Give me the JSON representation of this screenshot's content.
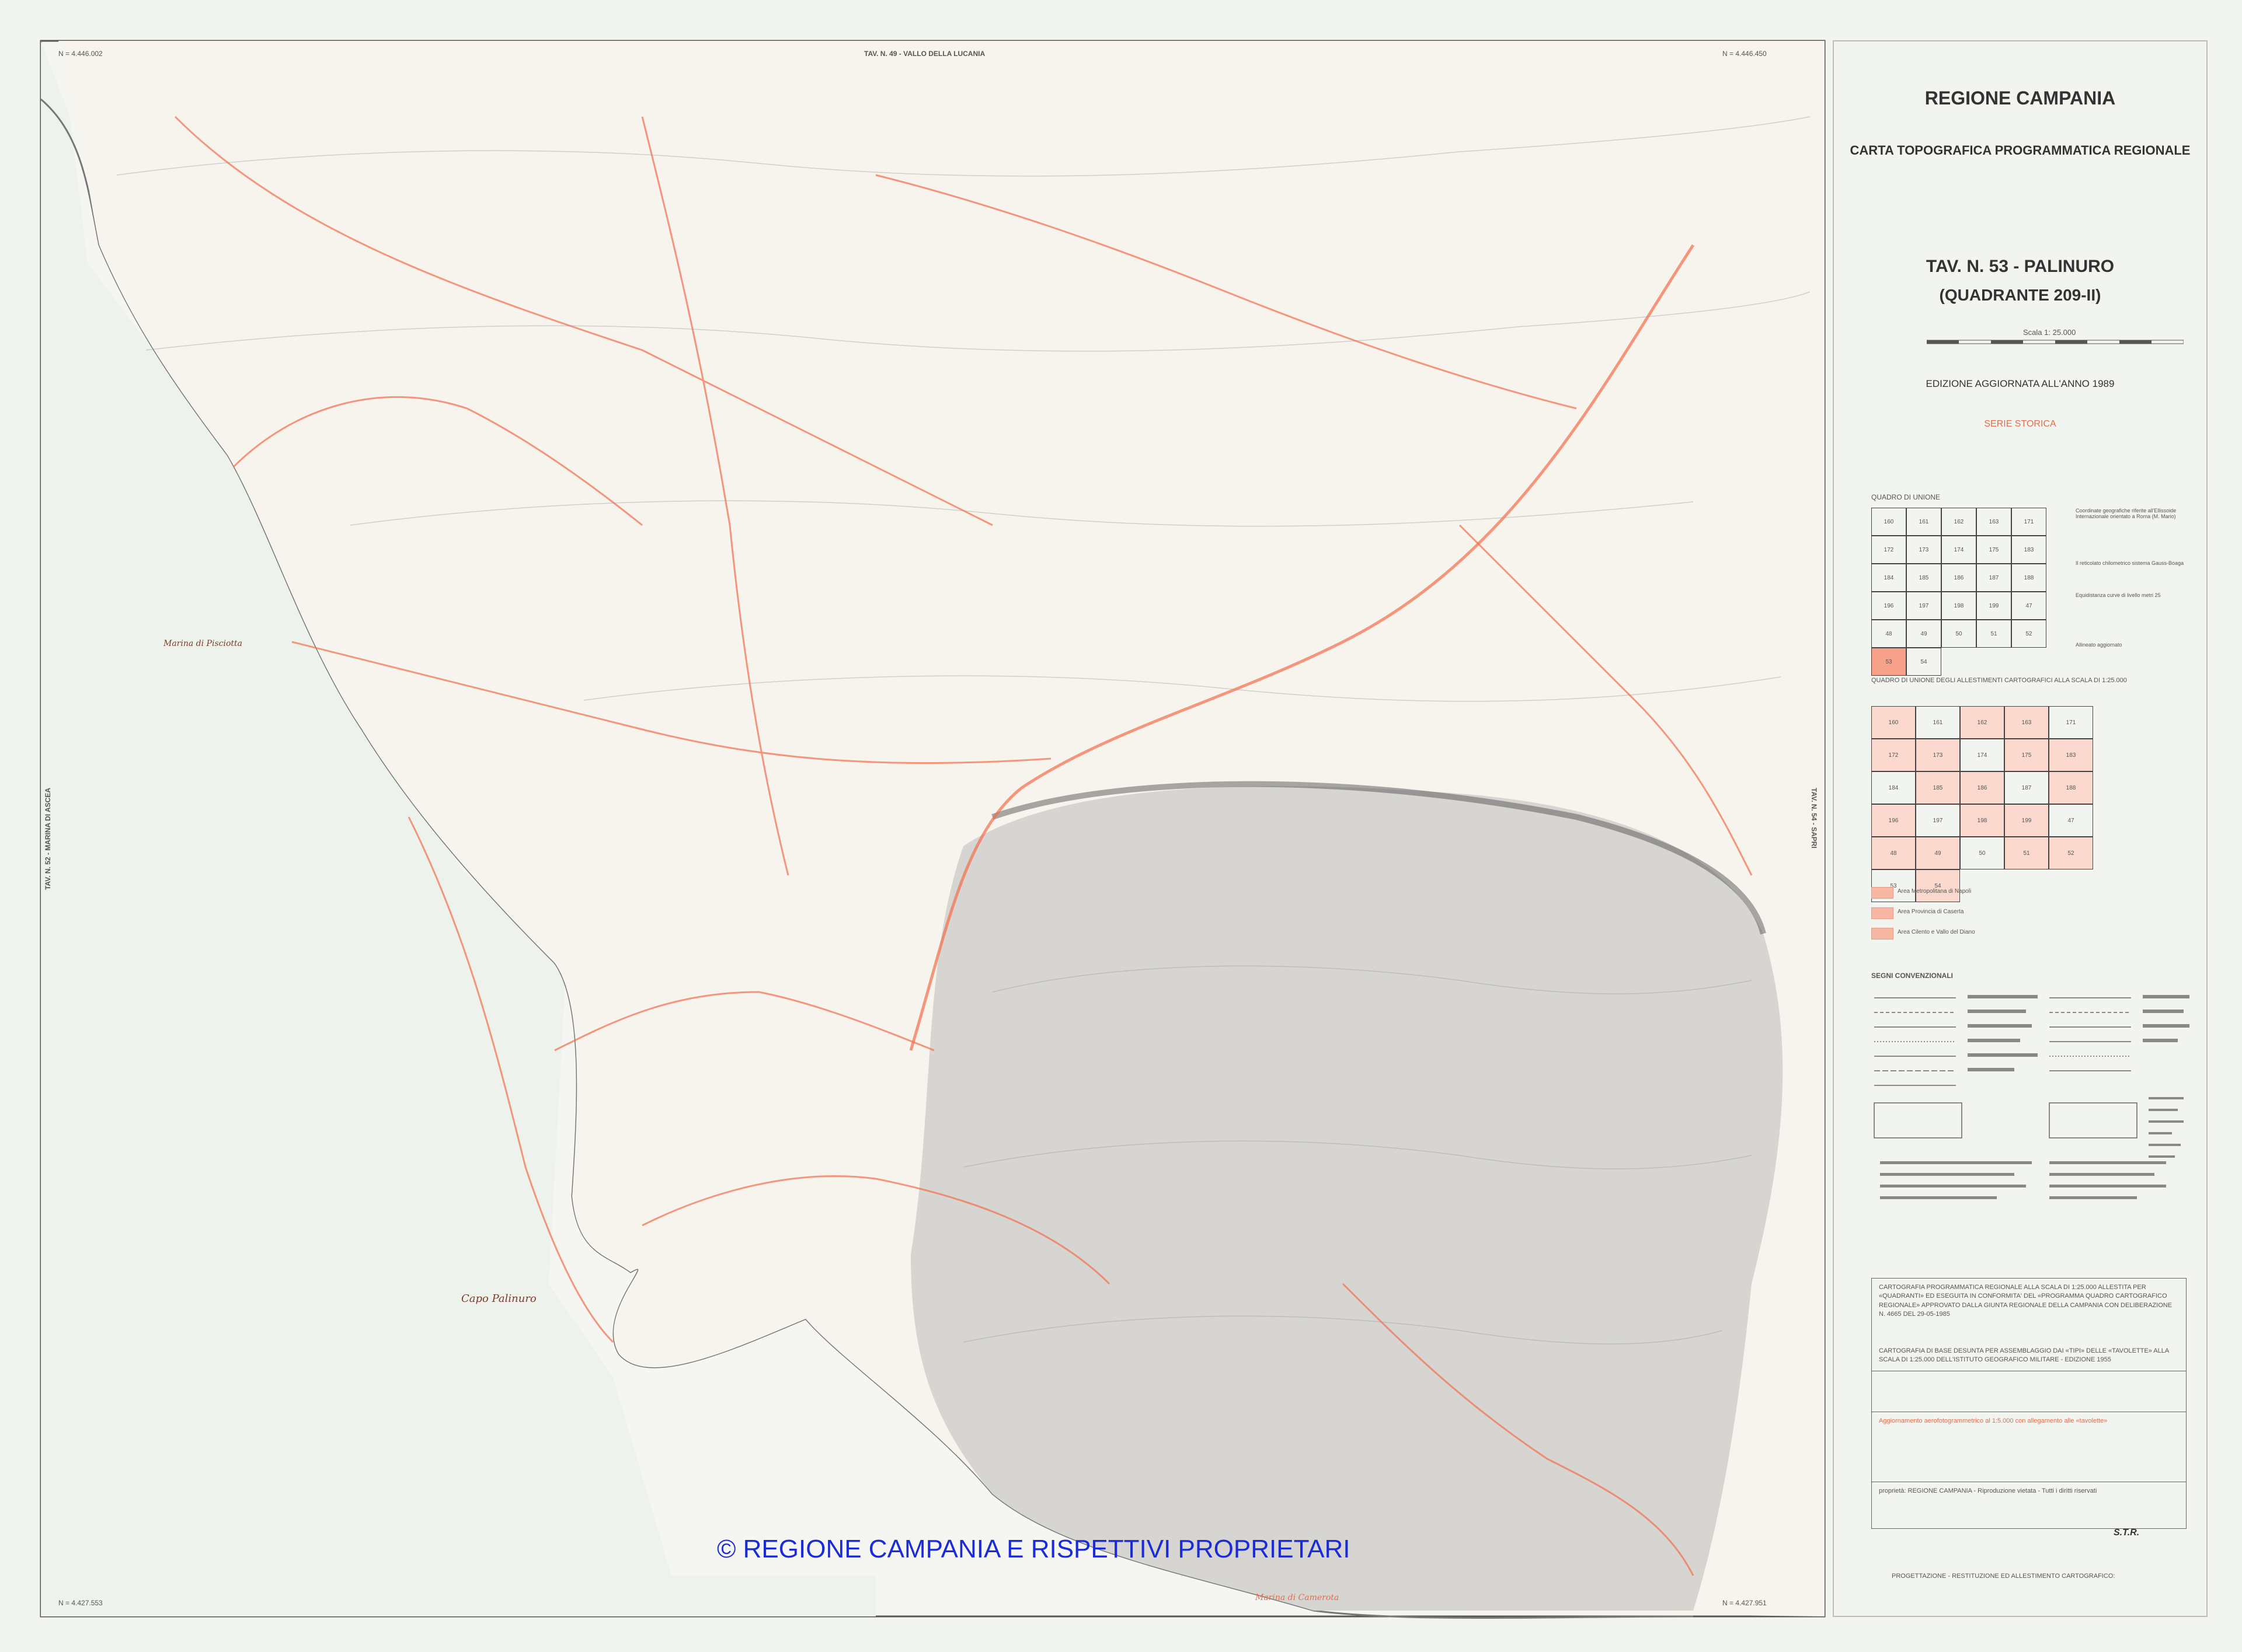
{
  "header": {
    "region": "REGIONE CAMPANIA",
    "subtitle": "CARTA TOPOGRAFICA PROGRAMMATICA REGIONALE",
    "sheet_title": "TAV. N. 53 - PALINURO",
    "quadrant": "(QUADRANTE 209-II)",
    "scale_label": "Scala 1: 25.000",
    "edition": "EDIZIONE AGGIORNATA ALL'ANNO 1989",
    "series": "SERIE STORICA"
  },
  "frame": {
    "top": "TAV. N. 49 - VALLO DELLA LUCANIA",
    "left": "TAV. N. 52 - MARINA DI ASCEA",
    "right": "TAV. N. 54 - SAPRI",
    "coord_top_left": "N = 4.446.002",
    "coord_top_right": "N = 4.446.450",
    "coord_bottom_left": "N = 4.427.553",
    "coord_bottom_right": "N = 4.427.951"
  },
  "index_panel": {
    "title1": "QUADRO DI UNIONE",
    "title2": "QUADRO DI UNIONE DEGLI ALLESTIMENTI CARTOGRAFICI ALLA SCALA DI 1:25.000",
    "grid1": [
      "160",
      "161",
      "162",
      "163",
      "171",
      "172",
      "173",
      "174",
      "175",
      "183",
      "184",
      "185",
      "186",
      "187",
      "188",
      "196",
      "197",
      "198",
      "199",
      "47",
      "48",
      "49",
      "50",
      "51",
      "52",
      "53",
      "54"
    ],
    "grid2": [
      "160",
      "161",
      "162",
      "163",
      "171",
      "172",
      "173",
      "174",
      "175",
      "183",
      "184",
      "185",
      "186",
      "187",
      "188",
      "196",
      "197",
      "198",
      "199",
      "47",
      "48",
      "49",
      "50",
      "51",
      "52",
      "53",
      "54"
    ],
    "highlight_cell": "53",
    "swatch_labels": [
      "Area Metropolitana di Napoli",
      "Area Provincia di Caserta",
      "Area Cilento e Vallo del Diano"
    ],
    "side_notes": [
      "Coordinate geografiche riferite all'Ellissoide Internazionale orientato a Roma (M. Mario)",
      "Il reticolato chilometrico sistema Gauss-Boaga",
      "Equidistanza curve di livello metri 25",
      "Allineato aggiornato"
    ]
  },
  "legend": {
    "title": "SEGNI CONVENZIONALI"
  },
  "notes": {
    "block1": "CARTOGRAFIA PROGRAMMATICA REGIONALE ALLA SCALA DI 1:25.000 ALLESTITA PER «QUADRANTI» ED ESEGUITA IN CONFORMITA' DEL «PROGRAMMA QUADRO CARTOGRAFICO REGIONALE» APPROVATO DALLA GIUNTA REGIONALE DELLA CAMPANIA CON DELIBERAZIONE N. 4665 DEL 29-05-1985",
    "block2": "CARTOGRAFIA DI BASE DESUNTA PER ASSEMBLAGGIO DAI «TIPI» DELLE «TAVOLETTE» ALLA SCALA DI 1:25.000 DELL'ISTITUTO GEOGRAFICO MILITARE - EDIZIONE 1955",
    "block3": "Aggiornamento aerofotogrammetrico al 1:5.000 con allegamento alle «tavolette»",
    "block4": "proprietà: REGIONE CAMPANIA - Riproduzione vietata - Tutti i diritti riservati",
    "block5": "PROGETTAZIONE - RESTITUZIONE ED ALLESTIMENTO CARTOGRAFICO:",
    "stamp": "S.T.R."
  },
  "places": [
    "Marina di Pisciotta",
    "Capo Palinuro",
    "Marina di Camerota"
  ],
  "copyright": "© REGIONE CAMPANIA E RISPETTIVI PROPRIETARI",
  "colors": {
    "paper": "#f2f4ef",
    "sea": "#eef2ec",
    "land": "#f7f3ee",
    "mountain": "#8c8c8c",
    "road": "#f26d4c",
    "copyright": "#1a2bd8"
  }
}
